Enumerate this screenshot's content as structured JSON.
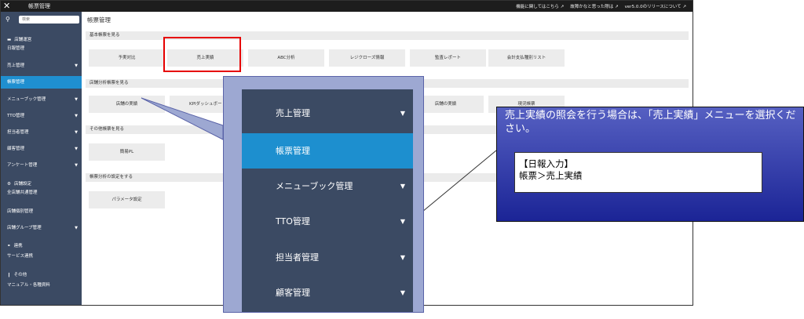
{
  "topbar": {
    "title": "帳票管理",
    "links": [
      "機能に関してはこちら",
      "故障かなと思った際は",
      "ver5.0.0のリリースについて"
    ]
  },
  "sidebar": {
    "search_placeholder": "検索",
    "section_store": "店舗運営",
    "section_store_settings": "店舗設定",
    "section_link": "連携",
    "section_other": "その他",
    "items": [
      {
        "label": "日報管理"
      },
      {
        "label": "売上管理"
      },
      {
        "label": "帳票管理"
      },
      {
        "label": "メニューブック管理"
      },
      {
        "label": "TTO管理"
      },
      {
        "label": "担当者管理"
      },
      {
        "label": "顧客管理"
      },
      {
        "label": "アンケート管理"
      },
      {
        "label": "全店舗共通管理"
      },
      {
        "label": "店舗個別管理"
      },
      {
        "label": "店舗グループ管理"
      },
      {
        "label": "サービス連携"
      },
      {
        "label": "マニュアル・各種資料"
      }
    ]
  },
  "main": {
    "page_title": "帳票管理",
    "sections": [
      {
        "title": "基本帳票を見る",
        "buttons": [
          "予実対比",
          "売上実績",
          "ABC分析",
          "レジクローズ情報",
          "監査レポート",
          "会計支払種別リスト"
        ]
      },
      {
        "title": "店舗分析帳票を見る",
        "buttons": [
          "店舗の実績",
          "KPIダッシュボード",
          "店舗の実績",
          "現況帳票"
        ]
      },
      {
        "title": "その他帳票を見る",
        "buttons": [
          "簡易PL"
        ]
      },
      {
        "title": "帳票分析の設定をする",
        "buttons": [
          "パラメータ設定"
        ]
      }
    ]
  },
  "callout": {
    "items": [
      "売上管理",
      "帳票管理",
      "メニューブック管理",
      "TTO管理",
      "担当者管理",
      "顧客管理"
    ]
  },
  "note": {
    "text": "売上実績の照会を行う場合は、「売上実績」メニューを選択ください。",
    "box_line1": "【日報入力】",
    "box_line2": "帳票＞売上実績"
  }
}
